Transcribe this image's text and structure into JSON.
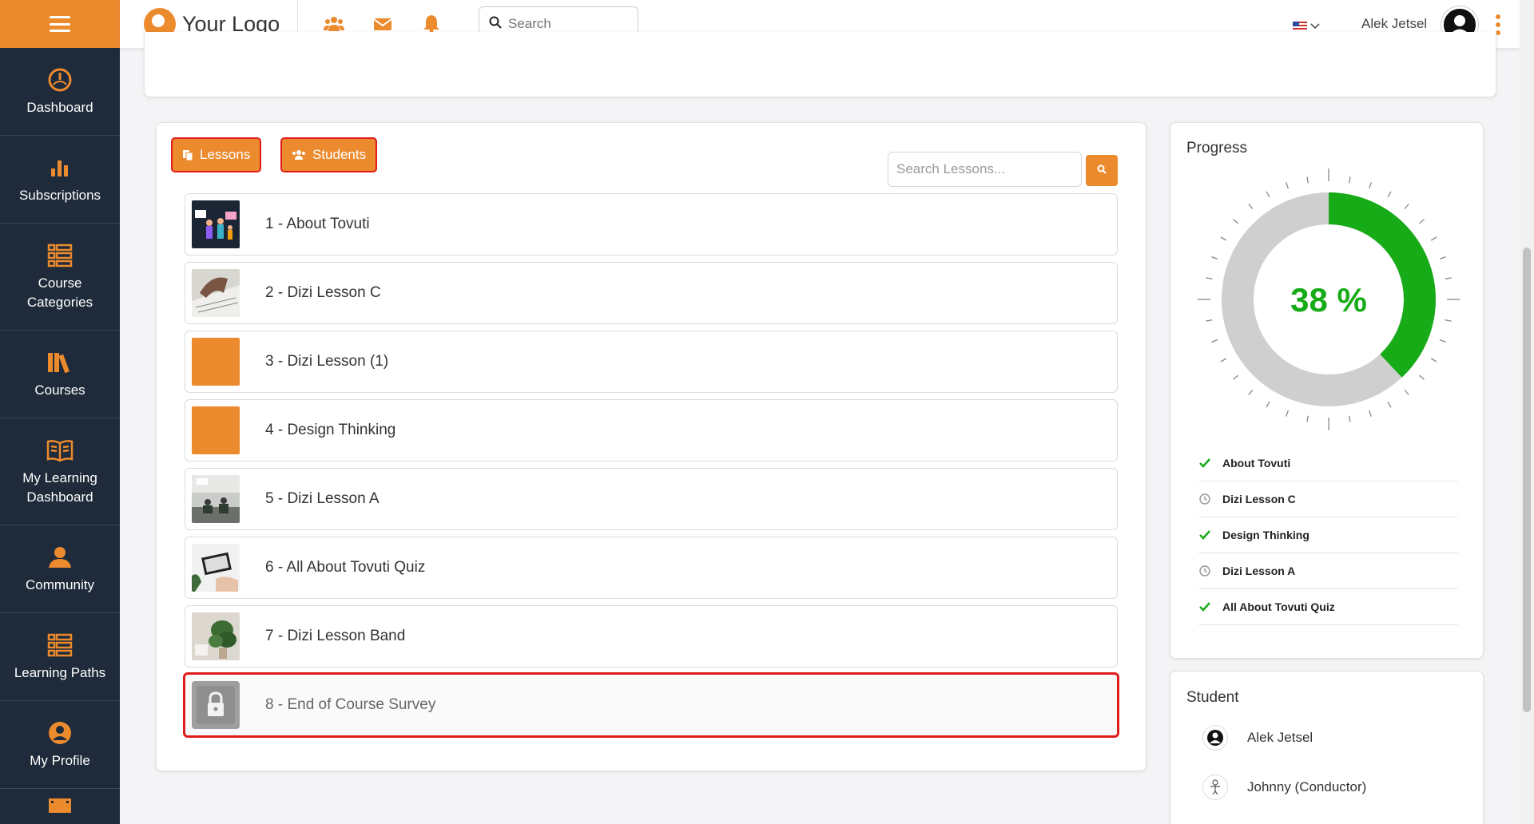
{
  "header": {
    "logo_text": "Your Logo",
    "search_placeholder": "Search",
    "username": "Alek Jetsel"
  },
  "sidebar": {
    "items": [
      {
        "label": "Dashboard",
        "icon": "gauge-icon"
      },
      {
        "label": "Subscriptions",
        "icon": "bar-chart-icon"
      },
      {
        "label": "Course Categories",
        "icon": "list-grid-icon"
      },
      {
        "label": "Courses",
        "icon": "books-icon"
      },
      {
        "label": "My Learning Dashboard",
        "icon": "open-book-icon"
      },
      {
        "label": "Community",
        "icon": "user-icon"
      },
      {
        "label": "Learning Paths",
        "icon": "list-grid-icon"
      },
      {
        "label": "My Profile",
        "icon": "user-circle-icon"
      }
    ]
  },
  "tabs": {
    "lessons_label": "Lessons",
    "students_label": "Students"
  },
  "lesson_search_placeholder": "Search Lessons...",
  "lessons": [
    {
      "title": "1 - About Tovuti",
      "thumb": "team-illustration"
    },
    {
      "title": "2 - Dizi Lesson C",
      "thumb": "photo-writing"
    },
    {
      "title": "3 - Dizi Lesson (1)",
      "thumb": "orange-placeholder"
    },
    {
      "title": "4 - Design Thinking",
      "thumb": "orange-placeholder"
    },
    {
      "title": "5 - Dizi Lesson A",
      "thumb": "photo-classroom"
    },
    {
      "title": "6 - All About Tovuti Quiz",
      "thumb": "photo-laptop"
    },
    {
      "title": "7 - Dizi Lesson Band",
      "thumb": "photo-plant"
    },
    {
      "title": "8 - End of Course Survey",
      "thumb": "lock",
      "locked": true
    }
  ],
  "progress": {
    "title": "Progress",
    "percent": 38,
    "percent_label": "38 %",
    "items": [
      {
        "label": "About Tovuti",
        "status": "complete"
      },
      {
        "label": "Dizi Lesson C",
        "status": "pending"
      },
      {
        "label": "Design Thinking",
        "status": "complete"
      },
      {
        "label": "Dizi Lesson A",
        "status": "pending"
      },
      {
        "label": "All About Tovuti Quiz",
        "status": "complete"
      }
    ],
    "colors": {
      "fill": "#18ab18",
      "track": "#cfcfcf"
    }
  },
  "students": {
    "title": "Student",
    "items": [
      {
        "name": "Alek Jetsel"
      },
      {
        "name": "Johnny (Conductor)"
      }
    ]
  },
  "colors": {
    "accent": "#ec8a2e",
    "sidebar": "#1f2b3a",
    "highlight": "#e01b1b"
  }
}
